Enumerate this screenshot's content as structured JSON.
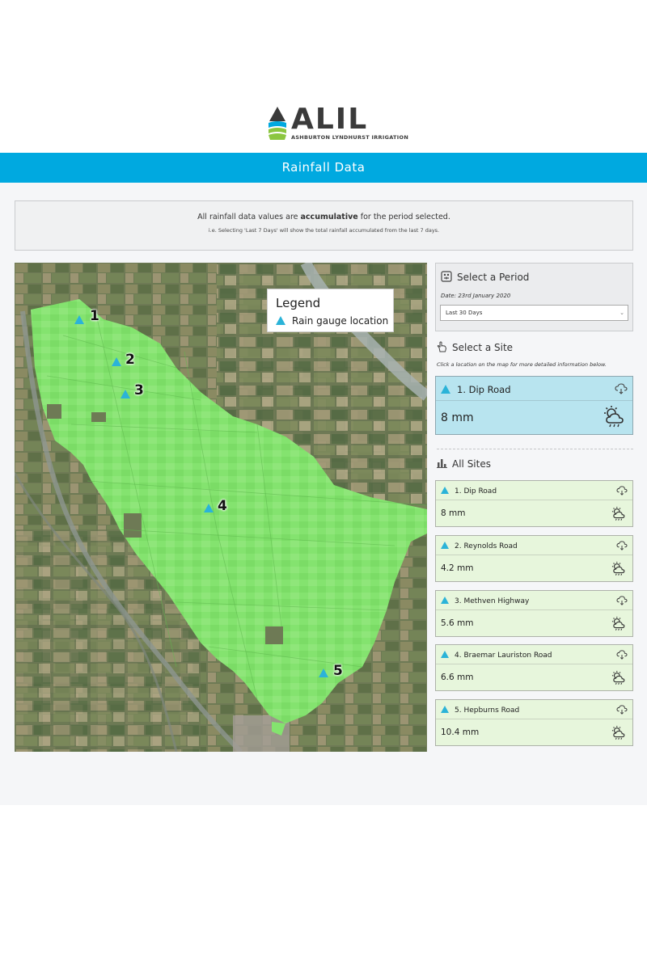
{
  "brand": {
    "logo_text": "ALIL",
    "logo_subtitle": "ASHBURTON LYNDHURST IRRIGATION"
  },
  "banner": {
    "title": "Rainfall Data"
  },
  "notice": {
    "line1_prefix": "All rainfall data values are ",
    "line1_bold": "accumulative",
    "line1_suffix": " for the period selected.",
    "line2": "i.e. Selecting 'Last 7 Days' will show the total rainfall accumulated from the last 7 days."
  },
  "map": {
    "legend_title": "Legend",
    "legend_item": "Rain gauge location",
    "markers": [
      "1",
      "2",
      "3",
      "4",
      "5"
    ],
    "colors": {
      "irrigation_area": "#7ee06a",
      "gauge": "#2bb3d8"
    }
  },
  "period": {
    "title": "Select a Period",
    "date": "Date: 23rd January 2020",
    "selected_option": "Last 30 Days"
  },
  "site_select": {
    "title": "Select a Site",
    "hint": "Click a location on the map for more detailed information below."
  },
  "selected_site": {
    "name": "1. Dip Road",
    "value": "8 mm"
  },
  "all_sites": {
    "title": "All Sites",
    "items": [
      {
        "name": "1. Dip Road",
        "value": "8 mm"
      },
      {
        "name": "2. Reynolds Road",
        "value": "4.2 mm"
      },
      {
        "name": "3. Methven Highway",
        "value": "5.6 mm"
      },
      {
        "name": "4. Braemar Lauriston Road",
        "value": "6.6 mm"
      },
      {
        "name": "5. Hepburns Road",
        "value": "10.4 mm"
      }
    ]
  },
  "icons": {
    "period": "calendar-clock-icon",
    "site": "pointer-hand-icon",
    "all_sites": "bar-chart-icon",
    "gauge": "triangle-icon",
    "cloud": "cloud-rain-icon",
    "weather": "partly-sunny-rain-icon"
  }
}
